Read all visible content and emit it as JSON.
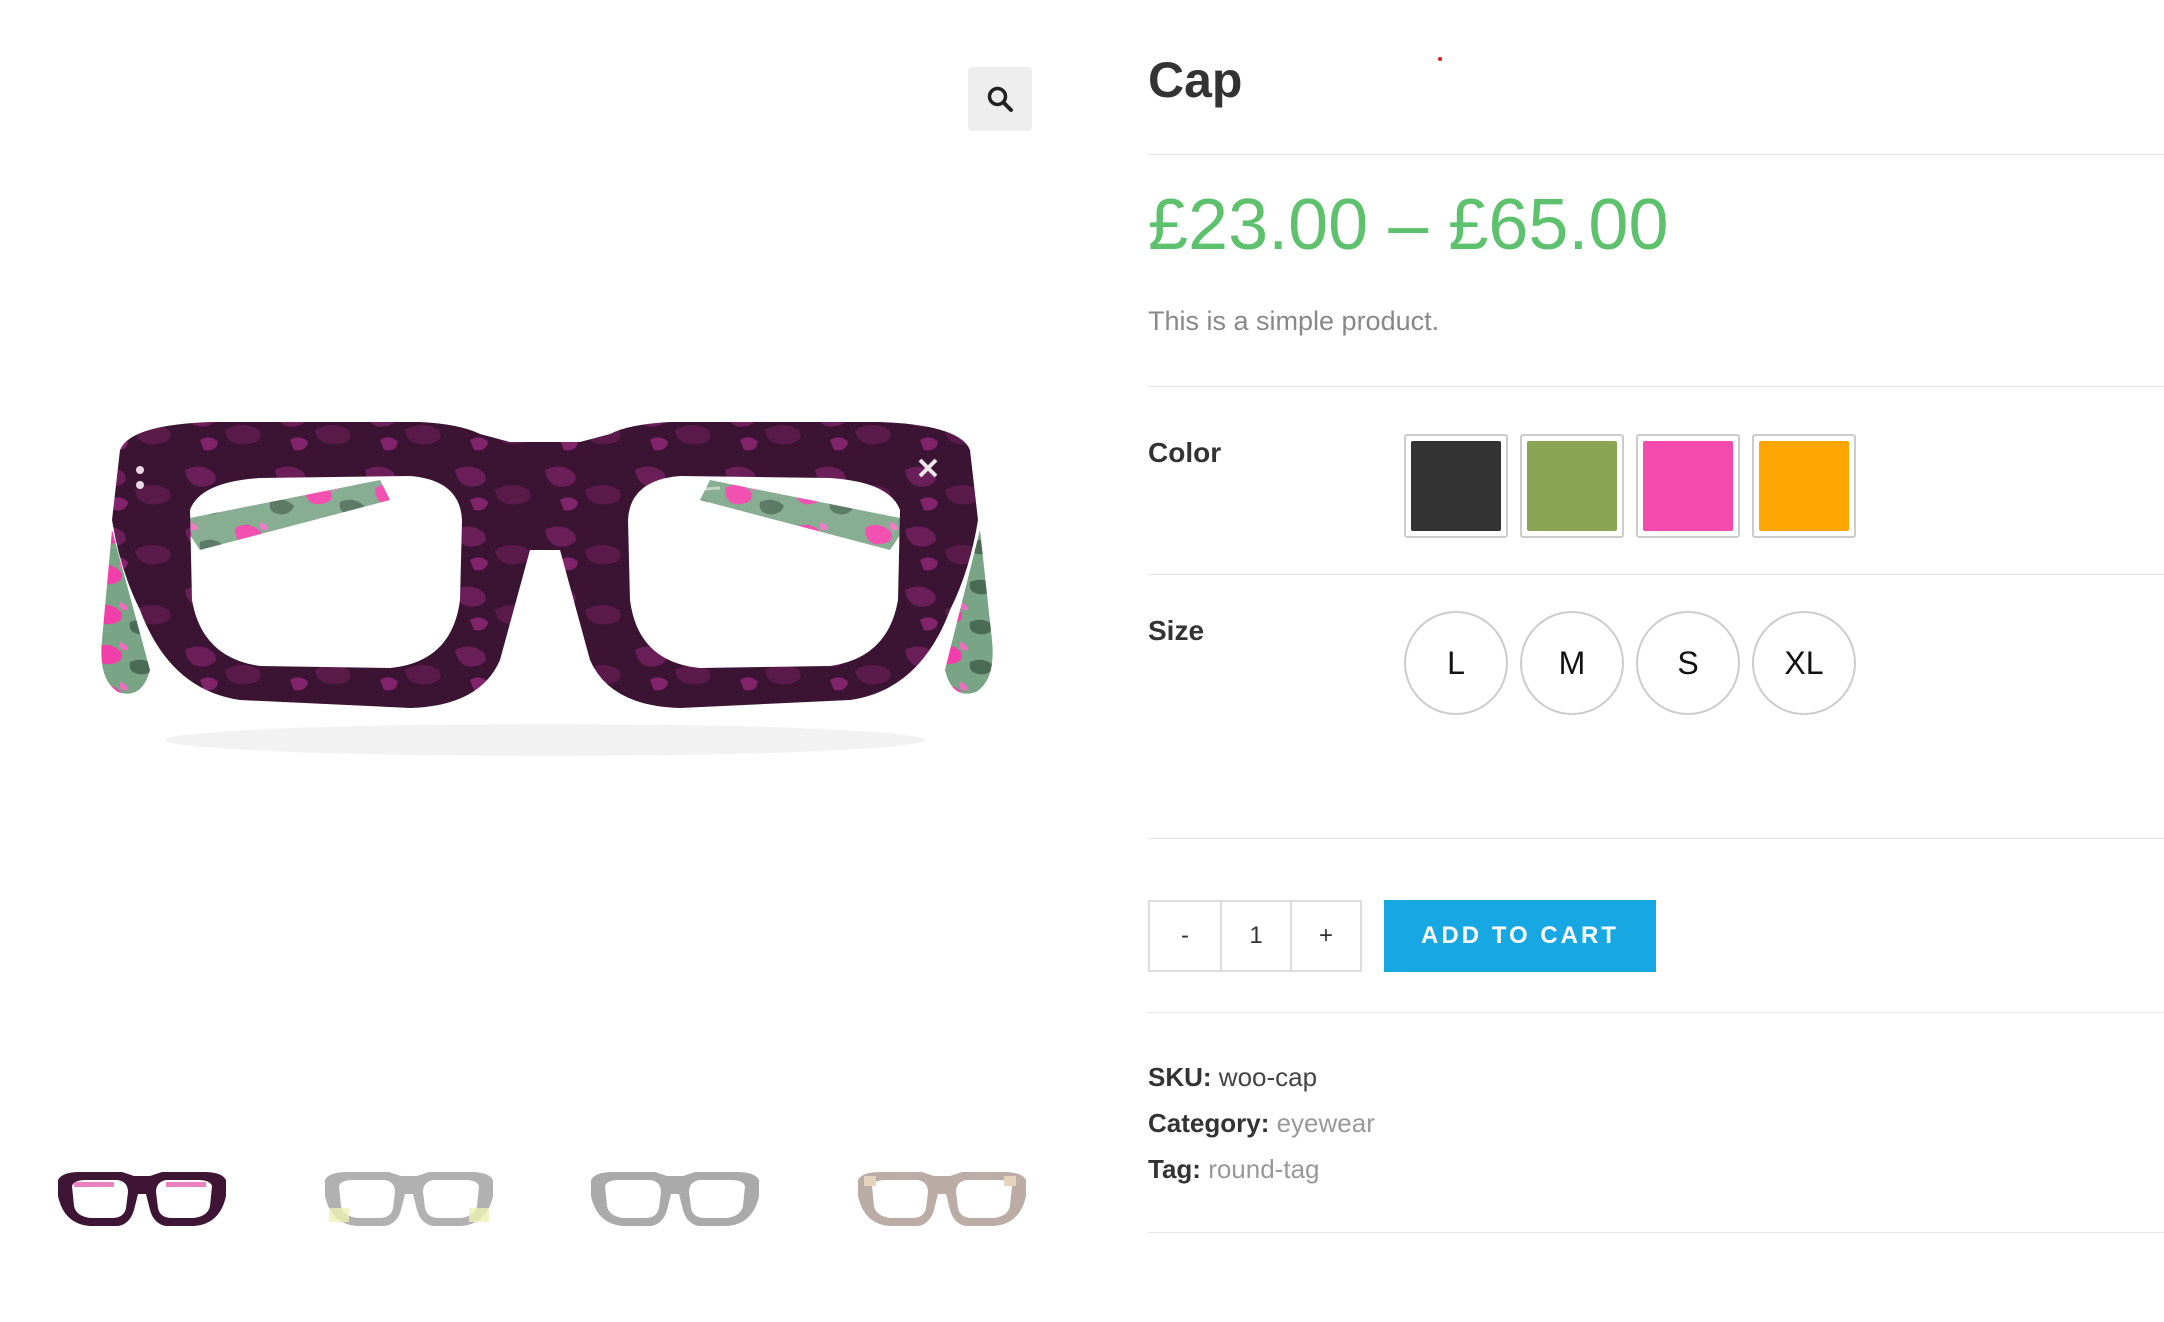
{
  "product": {
    "title": "Cap",
    "price": "£23.00 – £65.00",
    "short_description": "This is a simple product."
  },
  "gallery": {
    "zoom_icon": "magnifier-icon",
    "thumbnail_count": 4
  },
  "attributes": {
    "color": {
      "label": "Color",
      "options": [
        {
          "name": "black",
          "hex": "#333333"
        },
        {
          "name": "green",
          "hex": "#8aa553"
        },
        {
          "name": "pink",
          "hex": "#f54aad"
        },
        {
          "name": "orange",
          "hex": "#ffa602"
        }
      ]
    },
    "size": {
      "label": "Size",
      "options": [
        "L",
        "M",
        "S",
        "XL"
      ]
    }
  },
  "cart": {
    "decrement": "-",
    "quantity": "1",
    "increment": "+",
    "add_to_cart": "ADD TO CART",
    "button_color": "#17a8e3"
  },
  "meta": {
    "sku_label": "SKU:",
    "sku": "woo-cap",
    "category_label": "Category:",
    "category": "eyewear",
    "tag_label": "Tag:",
    "tag": "round-tag"
  },
  "colors": {
    "price": "#5ec16d",
    "title": "#333333"
  }
}
